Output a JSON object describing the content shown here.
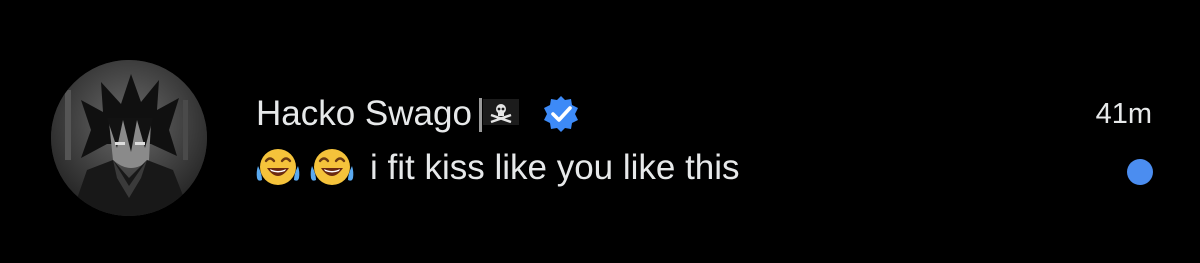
{
  "conversation": {
    "sender_name": "Hacko Swago",
    "timestamp": "41m",
    "message_text": "i fit kiss like you like this",
    "message_emojis": [
      "face-with-tears-of-joy",
      "face-with-tears-of-joy"
    ],
    "verified": true,
    "unread": true
  },
  "icons": {
    "avatar": "anime-avatar-image",
    "name_badge": "pirate-flag-icon",
    "verified_badge": "verified-check-icon"
  },
  "colors": {
    "background": "#000000",
    "text": "#e7e9ea",
    "accent": "#4b8df0",
    "verified": "#3d8af7"
  }
}
